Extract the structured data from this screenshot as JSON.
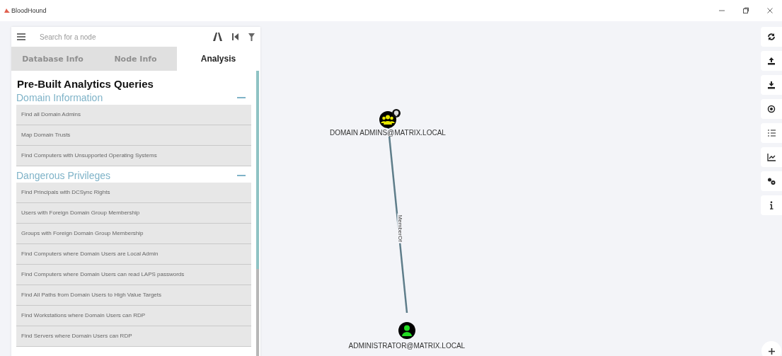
{
  "window": {
    "title": "BloodHound"
  },
  "search": {
    "placeholder": "Search for a node"
  },
  "tabs": [
    {
      "label": "Database Info",
      "selected": false
    },
    {
      "label": "Node Info",
      "selected": false
    },
    {
      "label": "Analysis",
      "selected": true
    }
  ],
  "panel_title": "Pre-Built Analytics Queries",
  "sections": [
    {
      "title": "Domain Information",
      "expanded": true,
      "queries": [
        "Find all Domain Admins",
        "Map Domain Trusts",
        "Find Computers with Unsupported Operating Systems"
      ]
    },
    {
      "title": "Dangerous Privileges",
      "expanded": true,
      "queries": [
        "Find Principals with DCSync Rights",
        "Users with Foreign Domain Group Membership",
        "Groups with Foreign Domain Group Membership",
        "Find Computers where Domain Users are Local Admin",
        "Find Computers where Domain Users can read LAPS passwords",
        "Find All Paths from Domain Users to High Value Targets",
        "Find Workstations where Domain Users can RDP",
        "Find Servers where Domain Users can RDP"
      ]
    }
  ],
  "graph": {
    "nodes": [
      {
        "label": "DOMAIN ADMINS@MATRIX.LOCAL",
        "kind": "group"
      },
      {
        "label": "ADMINISTRATOR@MATRIX.LOCAL",
        "kind": "user"
      }
    ],
    "edges": [
      {
        "label": "MemberOf"
      }
    ]
  }
}
